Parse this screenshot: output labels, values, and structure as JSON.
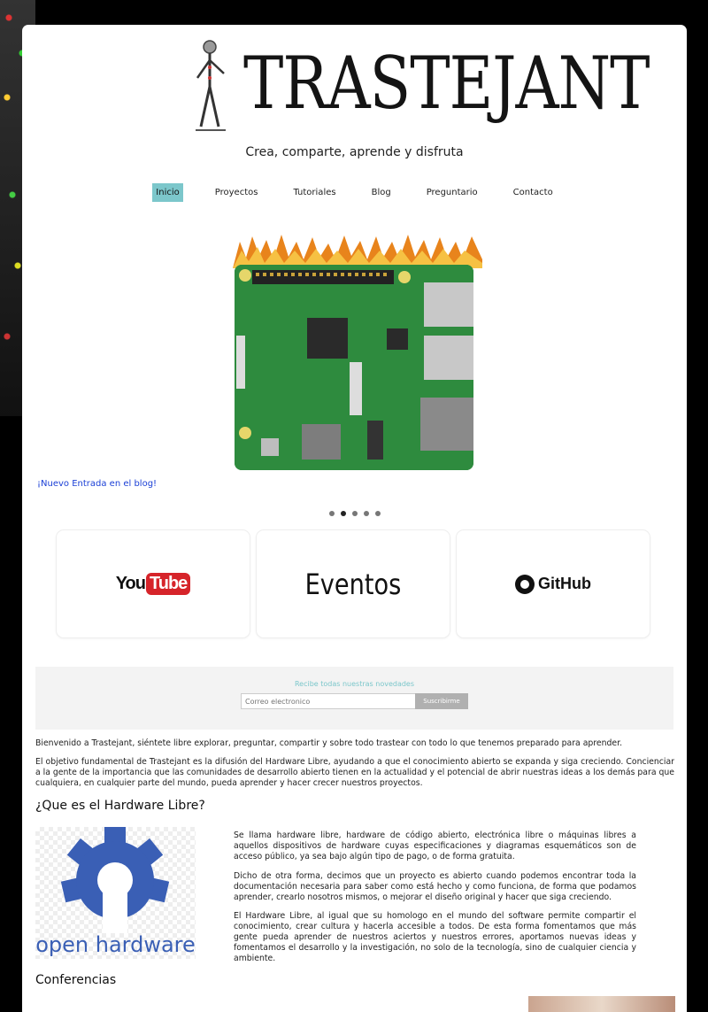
{
  "site": {
    "logo_text": "TRASTEJANT",
    "tagline": "Crea, comparte, aprende y disfruta"
  },
  "nav": {
    "items": [
      "Inicio",
      "Proyectos",
      "Tutoriales",
      "Blog",
      "Preguntario",
      "Contacto"
    ],
    "active": "Inicio"
  },
  "slider": {
    "caption": "¡Nuevo Entrada en el blog!",
    "dots_count": 5,
    "active_dot": 2
  },
  "cards": {
    "youtube_you": "You",
    "youtube_tube": "Tube",
    "eventos": "Eventos",
    "github": "GitHub"
  },
  "newsletter": {
    "title": "Recibe todas nuestras novedades",
    "placeholder": "Correo electronico",
    "button": "Suscribirme"
  },
  "intro": {
    "p1": "Bienvenido a Trastejant, siéntete libre explorar, preguntar, compartir y sobre todo trastear con todo lo que tenemos preparado para aprender.",
    "p2": "El objetivo fundamental de Trastejant es la difusión del Hardware Libre, ayudando a que el conocimiento abierto se expanda y siga creciendo. Concienciar a la gente de la importancia que las comunidades de desarrollo abierto tienen en la actualidad y el potencial de abrir nuestras ideas a los demás para que cualquiera, en cualquier parte del mundo, pueda aprender y hacer crecer nuestros proyectos."
  },
  "hardware": {
    "heading": "¿Que es el Hardware Libre?",
    "logo_text": "open hardware",
    "p1": "Se llama hardware libre, hardware de código abierto, electrónica libre o máquinas libres a aquellos dispositivos de hardware cuyas especificaciones y diagramas esquemáticos son de acceso público, ya sea bajo algún tipo de pago, o de forma gratuita.",
    "p2": "Dicho de otra forma, decimos que un proyecto es abierto cuando podemos encontrar toda la documentación necesaria para saber como está hecho y como funciona, de forma que podamos aprender, crearlo nosotros mismos, o mejorar el diseño original y hacer que siga creciendo.",
    "p3": "El Hardware Libre, al igual que su homologo en el mundo del software permite compartir el conocimiento, crear cultura y hacerla accesible a todos. De esta forma fomentamos que más gente pueda aprender de nuestros aciertos y nuestros errores, aportamos nuevas ideas y fomentamos el desarrollo y la investigación, no solo de la tecnología, sino de cualquier ciencia y ambiente."
  },
  "conferencias": {
    "heading": "Conferencias"
  },
  "colors": {
    "accent": "#7cc7cb",
    "link": "#1a3fd6",
    "youtube_red": "#d6242a",
    "open_hardware_blue": "#3a5fb5"
  }
}
